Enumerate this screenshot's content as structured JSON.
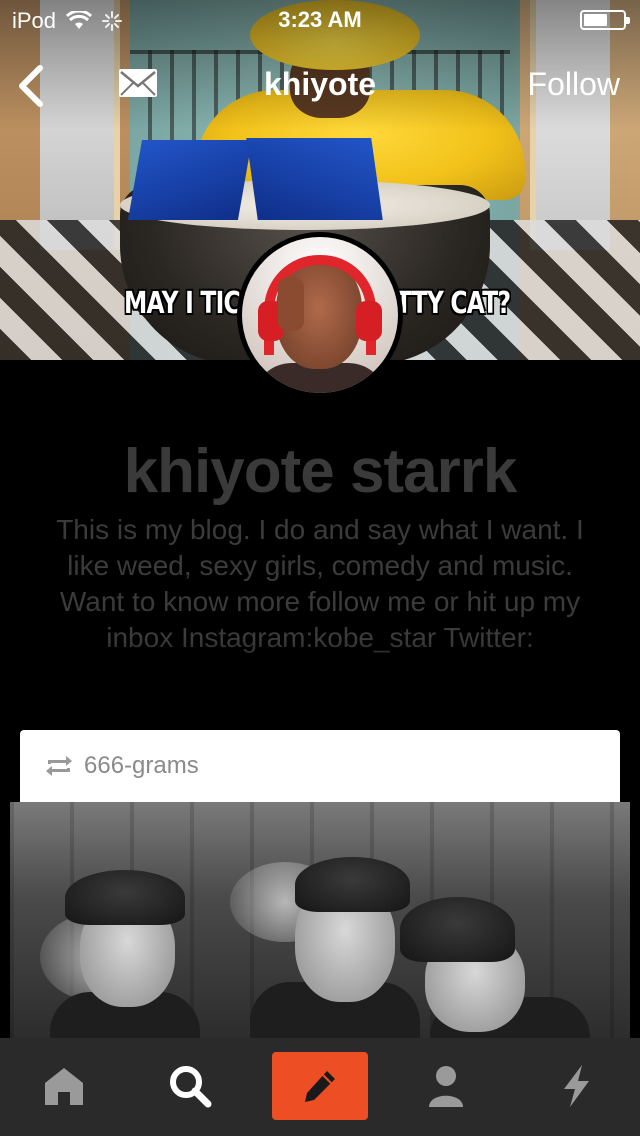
{
  "status_bar": {
    "carrier": "iPod",
    "time": "3:23 AM",
    "battery_level": 0.6
  },
  "nav": {
    "title": "khiyote",
    "follow_label": "Follow",
    "icons": [
      "back-chevron-icon",
      "mail-icon"
    ]
  },
  "header_image": {
    "caption_left": "MAY I TIC",
    "caption_right": "TTY CAT?"
  },
  "profile": {
    "name": "khiyote starrk",
    "bio": "This is my blog. I do and say what I want. I like weed, sexy girls, comedy and music. Want to know more follow me or hit up my inbox Instagram:kobe_star Twitter:"
  },
  "post": {
    "reblog_source": "666-grams",
    "icon": "reblog-icon"
  },
  "tab_bar": {
    "items": [
      "home-icon",
      "search-icon",
      "compose-icon",
      "account-icon",
      "activity-icon"
    ],
    "accent_color": "#ee4e23"
  }
}
